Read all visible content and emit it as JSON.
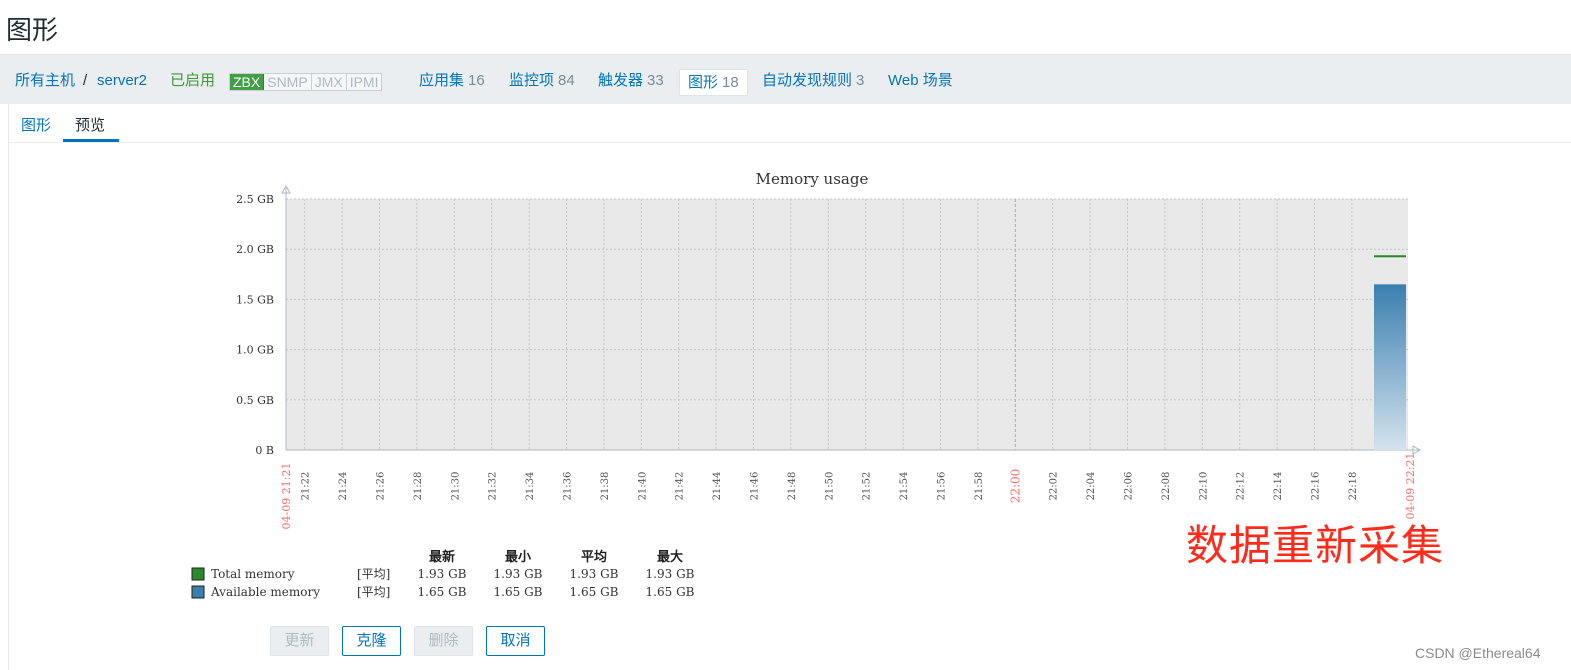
{
  "page": {
    "title": "图形"
  },
  "host_nav": {
    "all_hosts": "所有主机",
    "separator": "/",
    "host": "server2",
    "status": "已启用",
    "badges": [
      {
        "label": "ZBX",
        "active": true
      },
      {
        "label": "SNMP",
        "active": false
      },
      {
        "label": "JMX",
        "active": false
      },
      {
        "label": "IPMI",
        "active": false
      }
    ],
    "links": [
      {
        "label": "应用集",
        "count": "16"
      },
      {
        "label": "监控项",
        "count": "84"
      },
      {
        "label": "触发器",
        "count": "33"
      },
      {
        "label": "图形",
        "count": "18",
        "active": true
      },
      {
        "label": "自动发现规则",
        "count": "3"
      },
      {
        "label": "Web 场景",
        "count": ""
      }
    ]
  },
  "tabs": [
    {
      "label": "图形",
      "active": false
    },
    {
      "label": "预览",
      "active": true
    }
  ],
  "chart_data": {
    "type": "bar",
    "title": "Memory usage",
    "y_unit": "GB",
    "ylim": [
      0,
      2.5
    ],
    "y_ticks": [
      "0 B",
      "0.5 GB",
      "1.0 GB",
      "1.5 GB",
      "2.0 GB",
      "2.5 GB"
    ],
    "x_tick_labels": [
      "21:22",
      "21:24",
      "21:26",
      "21:28",
      "21:30",
      "21:32",
      "21:34",
      "21:36",
      "21:38",
      "21:40",
      "21:42",
      "21:44",
      "21:46",
      "21:48",
      "21:50",
      "21:52",
      "21:54",
      "21:56",
      "21:58",
      "22:00",
      "22:02",
      "22:04",
      "22:06",
      "22:08",
      "22:10",
      "22:12",
      "22:14",
      "22:16",
      "22:18"
    ],
    "x_start_label": "04-09 21:21",
    "x_end_label": "04-09 22:21",
    "series": [
      {
        "name": "Total memory",
        "func": "[平均]",
        "last": "1.93 GB",
        "min": "1.93 GB",
        "avg": "1.93 GB",
        "max": "1.93 GB",
        "value": 1.93,
        "color": "#2a8a2a",
        "style": "line"
      },
      {
        "name": "Available memory",
        "func": "[平均]",
        "last": "1.65 GB",
        "min": "1.65 GB",
        "avg": "1.65 GB",
        "max": "1.65 GB",
        "value": 1.65,
        "color": "#3a7fb0",
        "style": "filled"
      }
    ],
    "legend_headers": [
      "最新",
      "最小",
      "平均",
      "最大"
    ],
    "grid": true
  },
  "buttons": [
    {
      "label": "更新",
      "enabled": false
    },
    {
      "label": "克隆",
      "enabled": true
    },
    {
      "label": "删除",
      "enabled": false
    },
    {
      "label": "取消",
      "enabled": true
    }
  ],
  "annotation": "数据重新采集",
  "watermark": "CSDN @Ethereal64",
  "colors": {
    "link": "#0275b8",
    "enabled": "#3c9a31",
    "annotation": "#ff2a1a",
    "date_label": "#ff6a6a"
  }
}
